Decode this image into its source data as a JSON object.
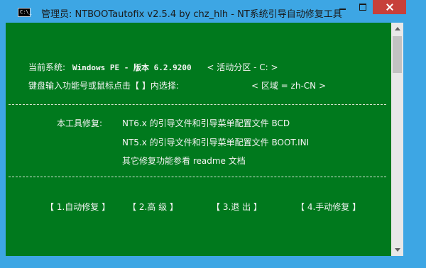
{
  "window": {
    "title": "管理员:  NTBOOTautofix v2.5.4 by chz_hlh - NT系统引导自动修复工具",
    "icon_text": "C:\\_"
  },
  "console": {
    "current_system_label": "当前系统:",
    "current_system_value": "Windows PE - 版本 6.2.9200",
    "active_partition": "< 活动分区 - C: >",
    "prompt": "键盘输入功能号或鼠标点击【 】内选择:",
    "region": "< 区域 = zh-CN >",
    "fix_label": "本工具修复:",
    "fix_nt6": "NT6.x 的引导文件和引导菜单配置文件 BCD",
    "fix_nt5": "NT5.x 的引导文件和引导菜单配置文件 BOOT.INI",
    "other": "其它修复功能参看 readme 文档"
  },
  "menu": {
    "auto": "【 1.自动修复 】",
    "advanced": "【  2.高  级  】",
    "exit": "【  3.退  出  】",
    "manual": "【 4.手动修复 】"
  },
  "colors": {
    "console_bg": "#00791d",
    "window_frame": "#3da6e4",
    "close_button": "#c7403a"
  }
}
